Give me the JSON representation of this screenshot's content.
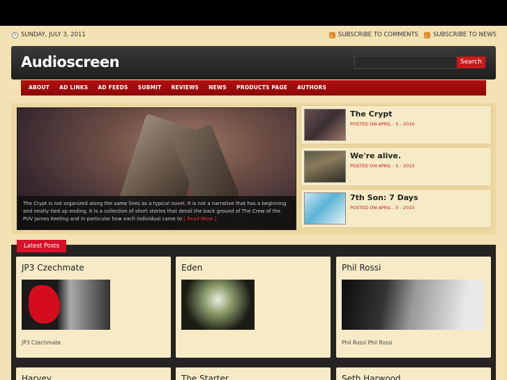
{
  "topbar": {
    "date": "SUNDAY, JULY 3, 2011",
    "subscribe_comments": "SUBSCRIBE TO COMMENTS",
    "subscribe_news": "SUBSCRIBE TO NEWS"
  },
  "header": {
    "logo": "Audioscreen",
    "search_placeholder": "",
    "search_button": "Search"
  },
  "nav": {
    "items": [
      "ABOUT",
      "AD LINKS",
      "AD FEEDS",
      "SUBMIT",
      "REVIEWS",
      "NEWS",
      "PRODUCTS PAGE",
      "AUTHORS"
    ]
  },
  "featured": {
    "caption": "The Crypt is not organized along the same lines as a typical novel. It is not a narrative that has a beginning and neatly tied up ending. It is a collection of short stories that detail the back ground of The Crew of the PUV James Keeling and in particular how each individual came to",
    "readmore": "[ Read More ]",
    "items": [
      {
        "title": "The Crypt",
        "meta": "POSTED ON APRIL - 5 - 2010"
      },
      {
        "title": "We're alive.",
        "meta": "POSTED ON APRIL - 5 - 2010"
      },
      {
        "title": "7th Son: 7 Days",
        "meta": "POSTED ON APRIL - 5 - 2010"
      }
    ]
  },
  "latest": {
    "tab": "Latest Posts",
    "cards": [
      {
        "title": "JP3 Czechmate",
        "text": "JP3 Czechmate"
      },
      {
        "title": "Eden",
        "text": ""
      },
      {
        "title": "Phil Rossi",
        "text": "Phil Rossi Phil Rossi"
      }
    ],
    "more": [
      {
        "title": "Harvey"
      },
      {
        "title": "The Starter"
      },
      {
        "title": "Seth Harwood"
      }
    ]
  },
  "colors": {
    "accent": "#c81a1a",
    "background": "#f3e2b3",
    "tab": "#d8102a"
  }
}
